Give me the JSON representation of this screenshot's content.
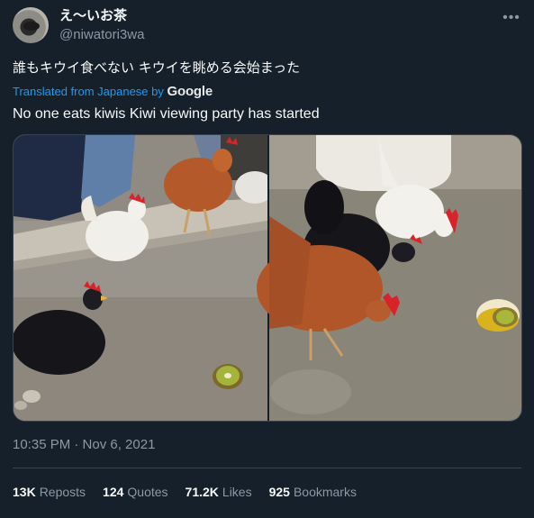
{
  "author": {
    "display_name": "え〜いお茶",
    "handle": "@niwatori3wa"
  },
  "more_icon": "more-horizontal-icon",
  "tweet": {
    "original_text": "誰もキウイ食べない キウイを眺める会始まった",
    "translated_from": "Translated from Japanese by",
    "translator": "Google",
    "translated_text": "No one eats kiwis Kiwi viewing party has started"
  },
  "timestamp": "10:35 PM · Nov 6, 2021",
  "stats": [
    {
      "count": "13K",
      "label": "Reposts"
    },
    {
      "count": "124",
      "label": "Quotes"
    },
    {
      "count": "71.2K",
      "label": "Likes"
    },
    {
      "count": "925",
      "label": "Bookmarks"
    }
  ],
  "colors": {
    "background": "#15202b",
    "accent": "#1d9bf0",
    "muted": "#8b98a5",
    "divider": "#38444d"
  }
}
